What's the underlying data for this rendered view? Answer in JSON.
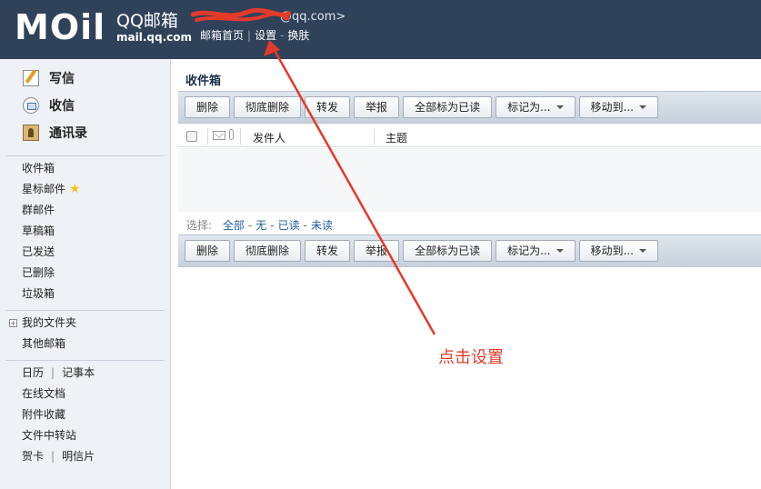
{
  "header": {
    "logo_mark": "MOil",
    "logo_title": "QQ邮箱",
    "logo_domain": "mail.qq.com",
    "account_email": "@qq.com>",
    "links": [
      "邮箱首页",
      "设置",
      "换肤"
    ],
    "link_sep_1": "|",
    "link_sep_2": "-"
  },
  "sidebar": {
    "main_nav": [
      {
        "label": "写信",
        "icon": "pencil-icon"
      },
      {
        "label": "收信",
        "icon": "inbox-icon"
      },
      {
        "label": "通讯录",
        "icon": "contacts-icon"
      }
    ],
    "folders": [
      "收件箱",
      "星标邮件",
      "群邮件",
      "草稿箱",
      "已发送",
      "已删除",
      "垃圾箱"
    ],
    "my_folders": "我的文件夹",
    "other_mailbox": "其他邮箱",
    "tools": {
      "calendar": "日历",
      "notes": "记事本",
      "online_docs": "在线文档",
      "attachments": "附件收藏",
      "transfer": "文件中转站",
      "card": "贺卡",
      "postcard": "明信片",
      "sep": "|"
    }
  },
  "main": {
    "title": "收件箱",
    "toolbar": {
      "delete": "删除",
      "delete_forever": "彻底删除",
      "forward": "转发",
      "report": "举报",
      "mark_all_read": "全部标为已读",
      "mark_as": "标记为...",
      "move_to": "移动到..."
    },
    "columns": {
      "sender": "发件人",
      "subject": "主题"
    },
    "select": {
      "label": "选择:",
      "all": "全部",
      "none": "无",
      "read": "已读",
      "unread": "未读",
      "dash": "-"
    }
  },
  "annotation": {
    "text": "点击设置",
    "color": "#e43a2a"
  },
  "colors": {
    "header_bg": "#2f4259",
    "sidebar_bg": "#eef2f6",
    "link": "#1f5d9e",
    "star": "#f5c518"
  }
}
